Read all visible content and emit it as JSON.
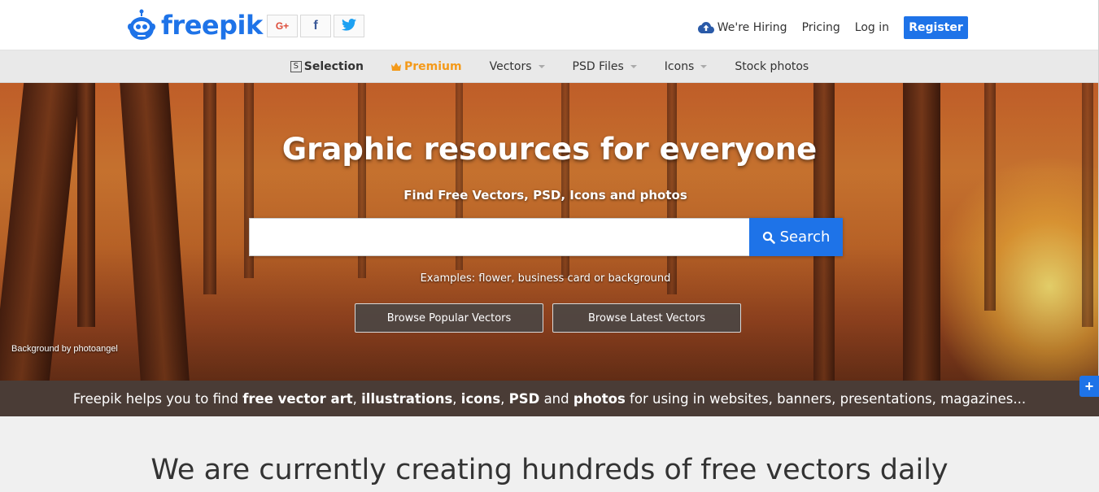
{
  "header": {
    "logo_text": "freepik",
    "social": [
      {
        "name": "google-plus",
        "glyph": "G+",
        "color": "#dd4b39"
      },
      {
        "name": "facebook",
        "glyph": "f",
        "color": "#3b5998"
      },
      {
        "name": "twitter",
        "glyph": "twitter",
        "color": "#1da1f2"
      }
    ],
    "nav": {
      "hiring": "We're Hiring",
      "pricing": "Pricing",
      "login": "Log in",
      "register": "Register"
    }
  },
  "categories": {
    "selection": "Selection",
    "premium": "Premium",
    "vectors": "Vectors",
    "psd": "PSD Files",
    "icons": "Icons",
    "stock": "Stock photos"
  },
  "hero": {
    "title": "Graphic resources for everyone",
    "subtitle": "Find Free Vectors, PSD, Icons and photos",
    "search_placeholder": "",
    "search_button": "Search",
    "examples": "Examples: flower, business card or background",
    "browse_popular": "Browse Popular Vectors",
    "browse_latest": "Browse Latest Vectors",
    "credit": "Background by photoangel"
  },
  "strip": {
    "prefix": "Freepik helps you to find ",
    "b1": "free vector art",
    "sep1": ", ",
    "b2": "illustrations",
    "sep2": ", ",
    "b3": "icons",
    "sep3": ", ",
    "b4": "PSD",
    "sep4": " and ",
    "b5": "photos",
    "suffix": " for using in websites, banners, presentations, magazines..."
  },
  "bottom_heading": "We are currently creating hundreds of free vectors daily",
  "colors": {
    "brand": "#1e73e8",
    "premium": "#f49a1a"
  }
}
